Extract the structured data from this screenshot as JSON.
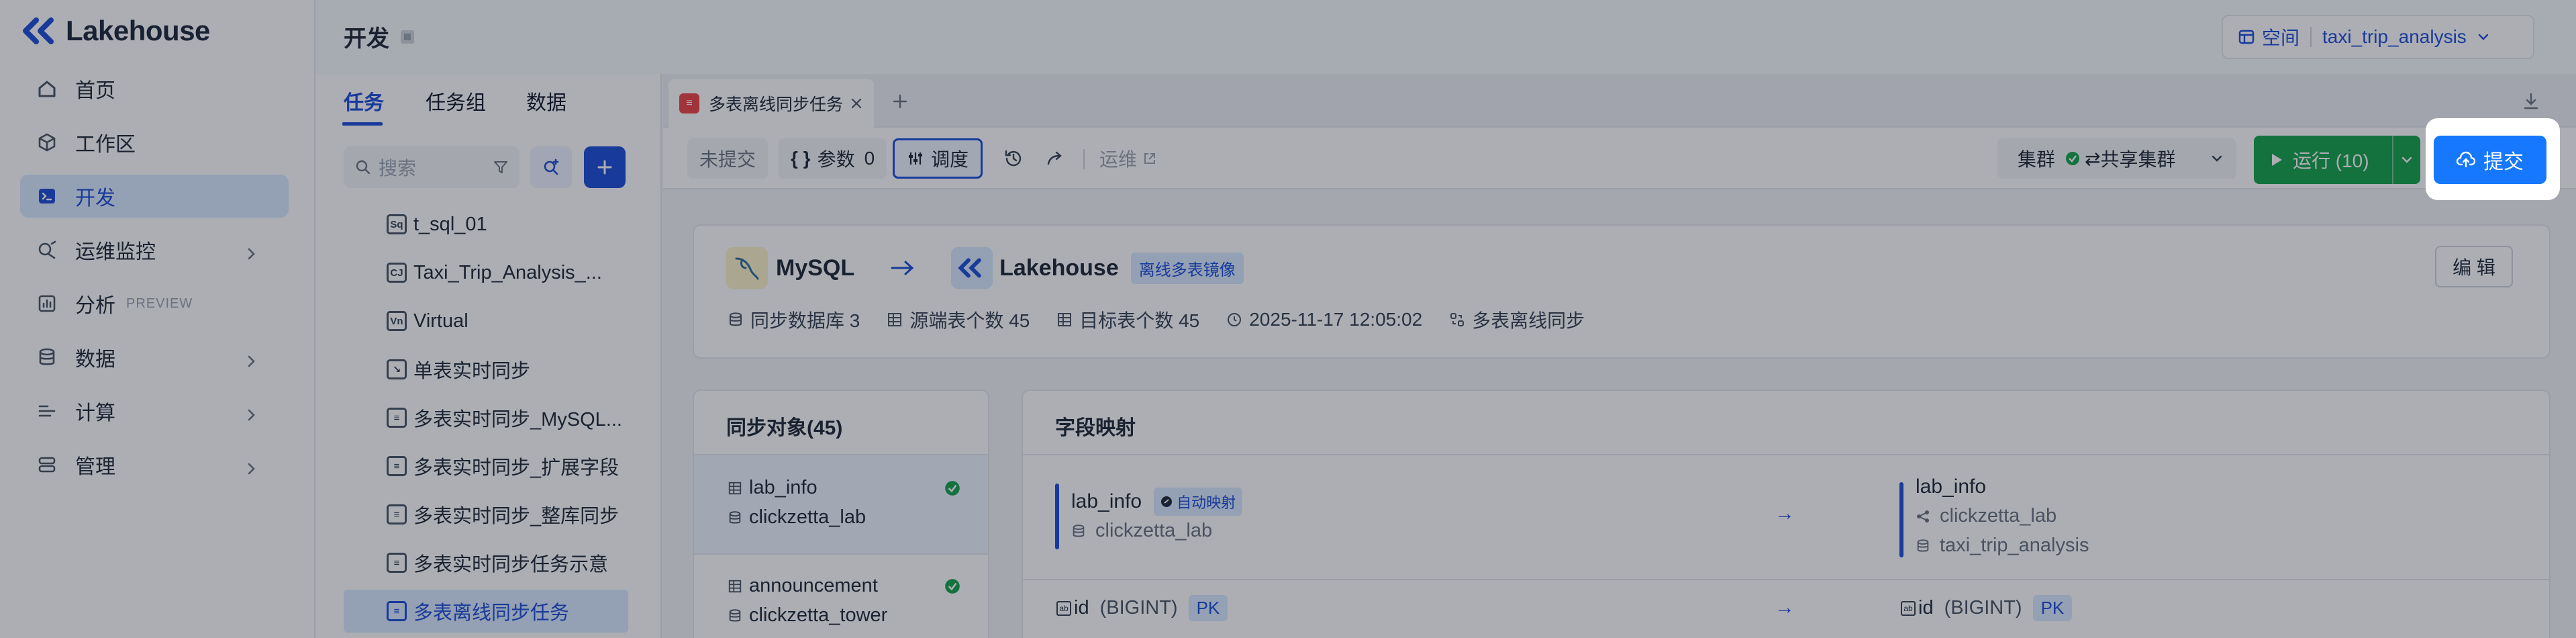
{
  "app": {
    "name": "Lakehouse"
  },
  "sidebar": {
    "items": [
      {
        "label": "首页",
        "icon": "home-icon"
      },
      {
        "label": "工作区",
        "icon": "cube-icon"
      },
      {
        "label": "开发",
        "icon": "terminal-icon",
        "active": true
      },
      {
        "label": "运维监控",
        "icon": "monitor-icon"
      },
      {
        "label": "分析",
        "icon": "chart-icon",
        "badge": "PREVIEW"
      },
      {
        "label": "数据",
        "icon": "database-icon"
      },
      {
        "label": "计算",
        "icon": "compute-icon"
      },
      {
        "label": "管理",
        "icon": "manage-icon"
      }
    ]
  },
  "header": {
    "title": "开发",
    "space_label": "空间",
    "space_value": "taxi_trip_analysis"
  },
  "left_panel": {
    "tabs": [
      "任务",
      "任务组",
      "数据"
    ],
    "search_placeholder": "搜索",
    "tree": [
      {
        "label": "t_sql_01",
        "icon": "Sq"
      },
      {
        "label": "Taxi_Trip_Analysis_...",
        "icon": "CJ"
      },
      {
        "label": "Virtual",
        "icon": "Vn"
      },
      {
        "label": "单表实时同步",
        "icon": "↘"
      },
      {
        "label": "多表实时同步_MySQL...",
        "icon": "≡"
      },
      {
        "label": "多表实时同步_扩展字段",
        "icon": "≡"
      },
      {
        "label": "多表实时同步_整库同步",
        "icon": "≡"
      },
      {
        "label": "多表实时同步任务示意",
        "icon": "≡"
      },
      {
        "label": "多表离线同步任务",
        "icon": "≡",
        "active": true
      }
    ]
  },
  "editor": {
    "tab_label": "多表离线同步任务",
    "toolbar": {
      "status": "未提交",
      "params_label": "参数",
      "params_count": "0",
      "schedule_label": "调度",
      "ops_label": "运维",
      "cluster_label": "集群",
      "cluster_value": "共享集群",
      "run_label": "运行 (10)",
      "submit_label": "提交"
    },
    "summary": {
      "source": "MySQL",
      "target": "Lakehouse",
      "tag": "离线多表镜像",
      "edit_label": "编 辑",
      "meta": [
        {
          "label": "同步数据库 3",
          "icon": "database-icon"
        },
        {
          "label": "源端表个数 45",
          "icon": "table-icon"
        },
        {
          "label": "目标表个数 45",
          "icon": "table-icon"
        },
        {
          "label": "2025-11-17 12:05:02",
          "icon": "clock-icon"
        },
        {
          "label": "多表离线同步",
          "icon": "sync-icon"
        }
      ]
    },
    "sync_objects": {
      "title": "同步对象(45)",
      "items": [
        {
          "name": "lab_info",
          "schema": "clickzetta_lab"
        },
        {
          "name": "announcement",
          "schema": "clickzetta_tower"
        }
      ]
    },
    "mapping": {
      "title": "字段映射",
      "source_table": "lab_info",
      "auto_label": "自动映射",
      "source_schema": "clickzetta_lab",
      "target_table": "lab_info",
      "target_workspace": "clickzetta_lab",
      "target_schema": "taxi_trip_analysis",
      "field_name": "id",
      "field_type": "(BIGINT)",
      "pk": "PK",
      "arrow": "→"
    }
  },
  "colors": {
    "brand": "#1d4ed8",
    "run": "#16a34a",
    "submit": "#1677ff",
    "success": "#16a34a"
  }
}
